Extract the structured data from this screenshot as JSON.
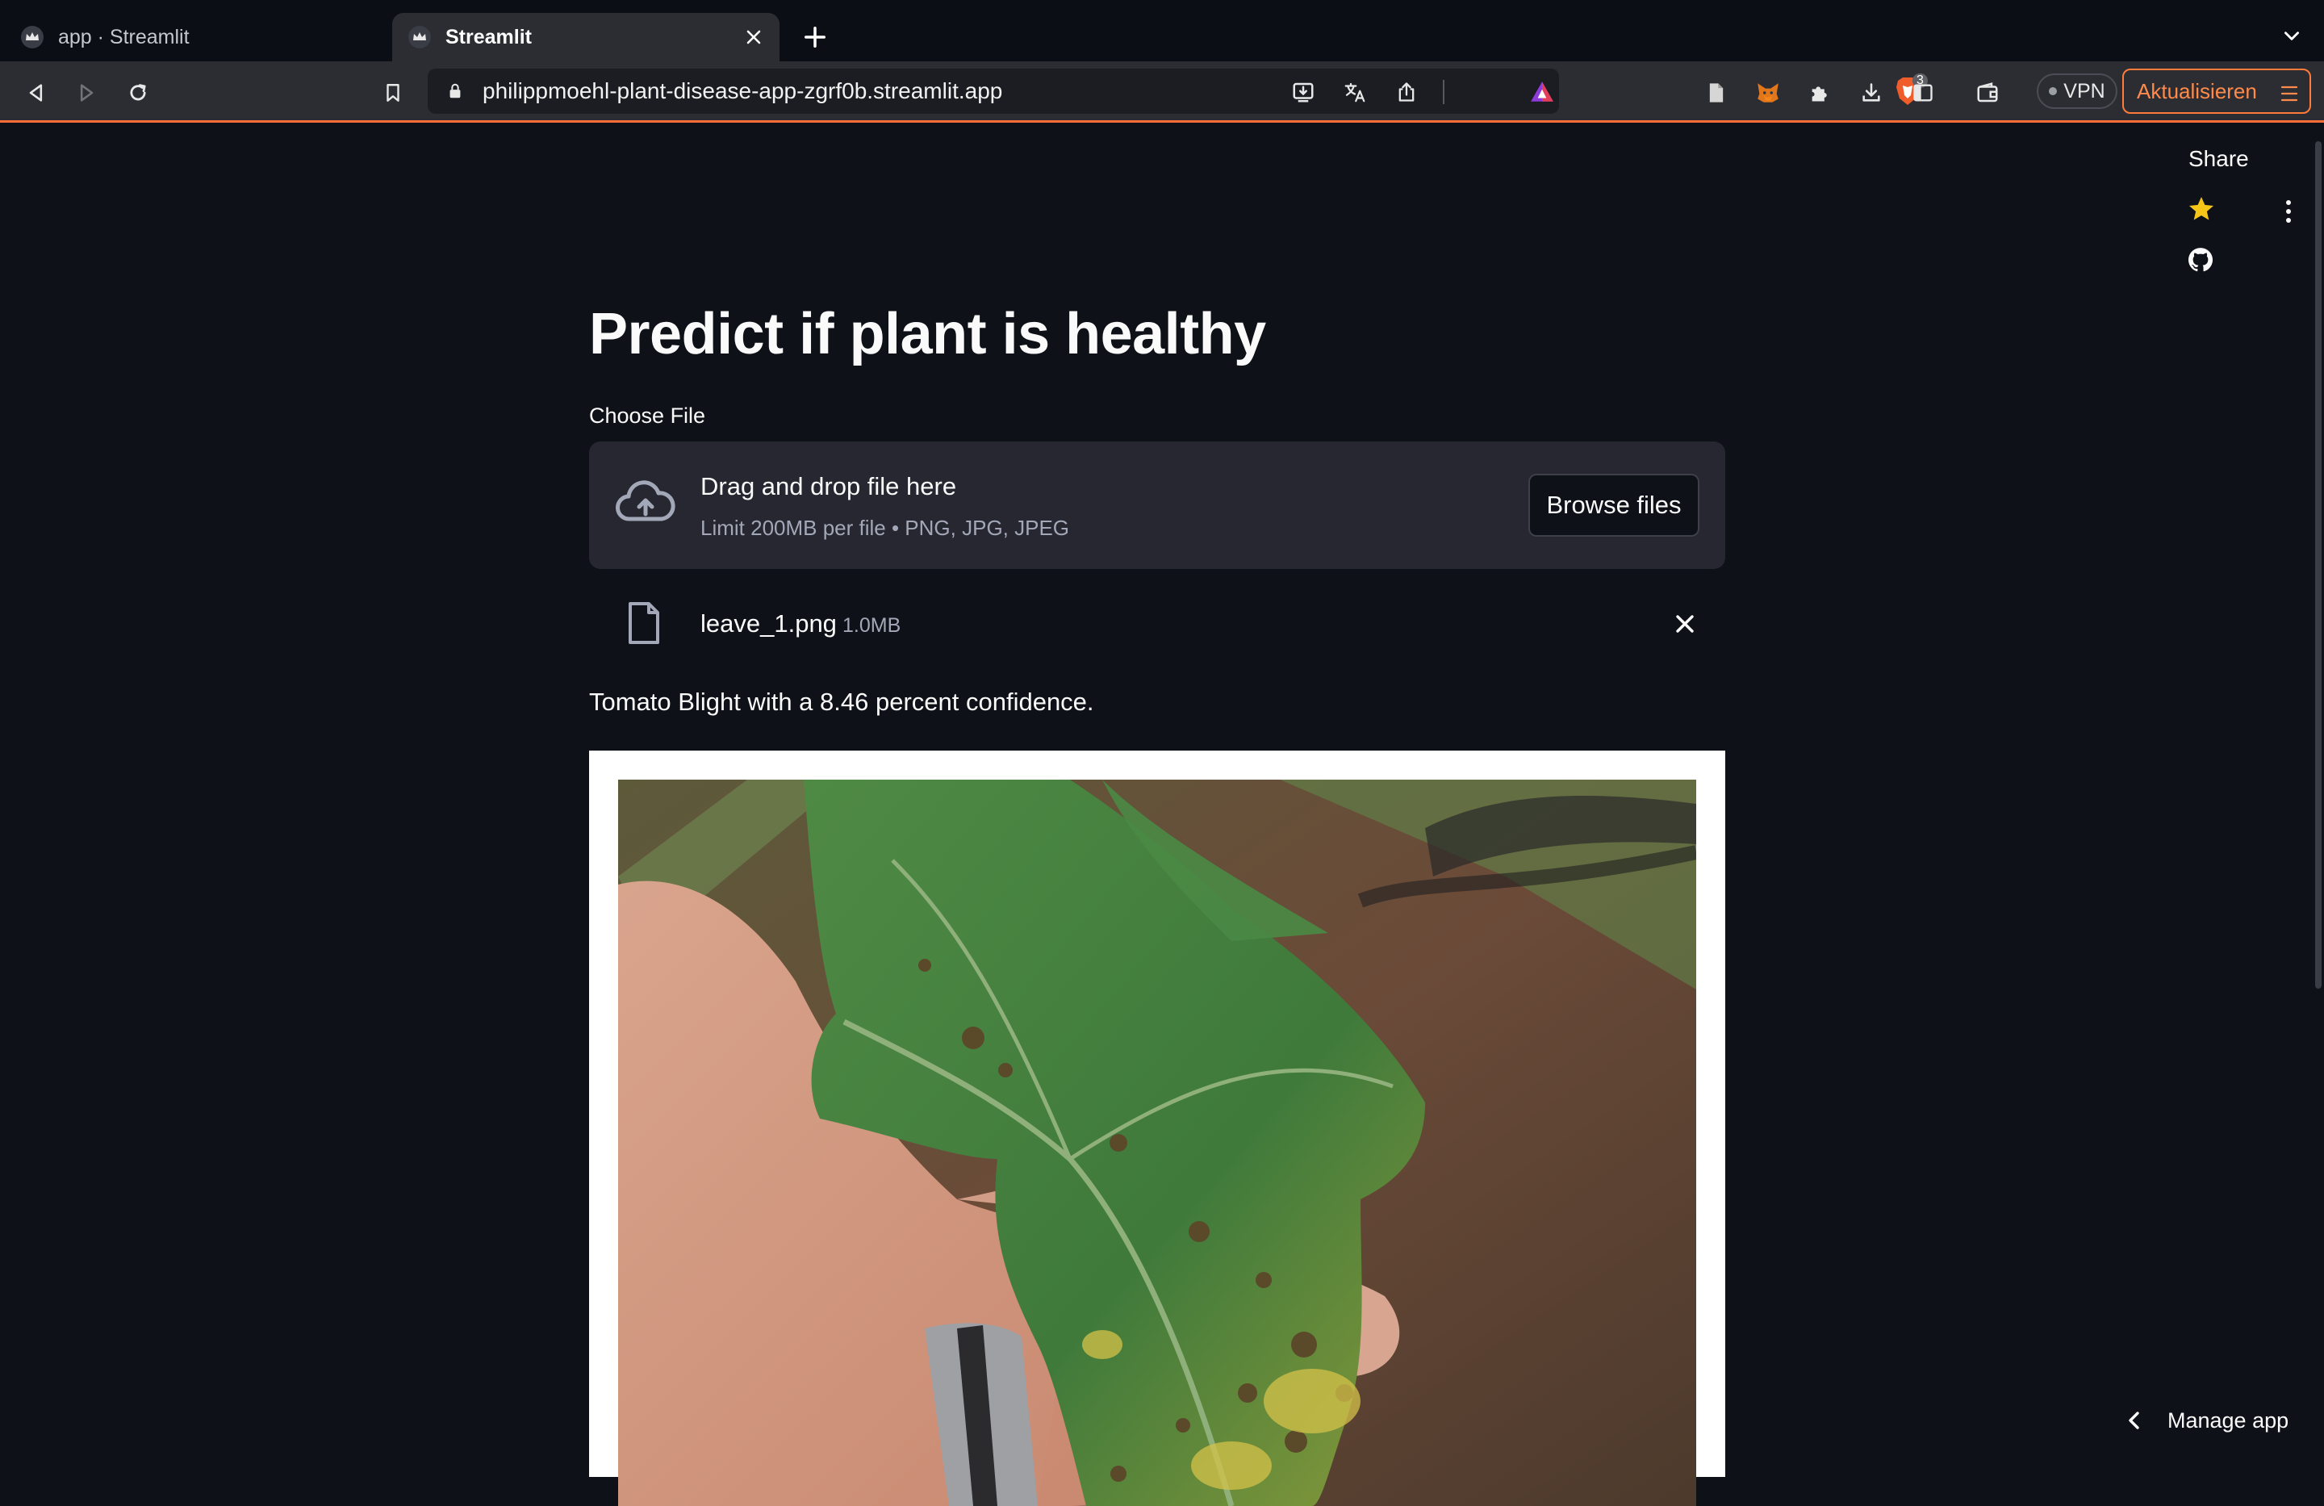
{
  "browser": {
    "tabs": [
      {
        "title": "app · Streamlit",
        "active": false
      },
      {
        "title": "Streamlit",
        "active": true
      }
    ],
    "url": "philippmoehl-plant-disease-app-zgrf0b.streamlit.app",
    "brave_shield_count": "3",
    "vpn_label": "VPN",
    "update_label": "Aktualisieren",
    "accent_color": "#ff7b3a"
  },
  "header": {
    "share_label": "Share"
  },
  "main": {
    "title": "Predict if plant is healthy",
    "uploader": {
      "label": "Choose File",
      "drop_title": "Drag and drop file here",
      "drop_subtitle": "Limit 200MB per file • PNG, JPG, JPEG",
      "browse_label": "Browse files"
    },
    "uploaded_file": {
      "name": "leave_1.png",
      "size": "1.0MB"
    },
    "prediction_text": "Tomato Blight with a 8.46 percent confidence."
  },
  "footer": {
    "manage_app_label": "Manage app"
  },
  "colors": {
    "background": "#0e1117",
    "dropzone": "#262730",
    "star": "#f5c518"
  }
}
